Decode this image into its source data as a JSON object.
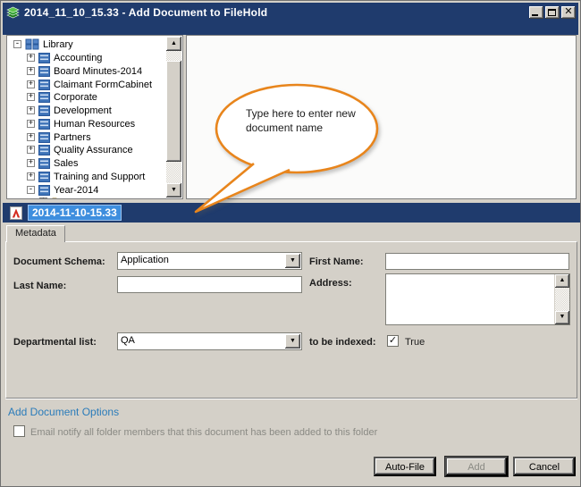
{
  "window": {
    "title": "2014_11_10_15.33 - Add Document to FileHold",
    "controls": [
      {
        "name": "minimize"
      },
      {
        "name": "maximize"
      },
      {
        "name": "close"
      }
    ],
    "app_icon": "filehold-green-layers-icon"
  },
  "colors": {
    "titlebar_navy": "#1f3b6d",
    "selection_blue": "#3e8ede",
    "callout_orange": "#e8851c",
    "link_blue": "#2b7cba",
    "chrome_gray": "#d4d0c8"
  },
  "tree": {
    "root": {
      "label": "Library",
      "toggle": "-",
      "icon": "library-grid-icon"
    },
    "items": [
      {
        "label": "Accounting",
        "toggle": "+",
        "icon": "cabinet-icon"
      },
      {
        "label": "Board Minutes-2014",
        "toggle": "+",
        "icon": "cabinet-icon"
      },
      {
        "label": "Claimant FormCabinet",
        "toggle": "+",
        "icon": "cabinet-icon"
      },
      {
        "label": "Corporate",
        "toggle": "+",
        "icon": "cabinet-icon"
      },
      {
        "label": "Development",
        "toggle": "+",
        "icon": "cabinet-icon"
      },
      {
        "label": "Human Resources",
        "toggle": "+",
        "icon": "cabinet-icon"
      },
      {
        "label": "Partners",
        "toggle": "+",
        "icon": "cabinet-icon"
      },
      {
        "label": "Quality Assurance",
        "toggle": "+",
        "icon": "cabinet-icon"
      },
      {
        "label": "Sales",
        "toggle": "+",
        "icon": "cabinet-icon"
      },
      {
        "label": "Training and Support",
        "toggle": "+",
        "icon": "cabinet-icon"
      },
      {
        "label": "Year-2014",
        "toggle": "-",
        "icon": "cabinet-icon"
      }
    ],
    "partial_item_icon": "folder-icon"
  },
  "callout": {
    "text": "Type here to enter new document name"
  },
  "filename": {
    "icon": "pdf-icon",
    "value": "2014-11-10-15.33"
  },
  "tab": {
    "label": "Metadata"
  },
  "form": {
    "schema": {
      "label": "Document Schema:",
      "value": "Application"
    },
    "first_name": {
      "label": "First Name:",
      "value": ""
    },
    "last_name": {
      "label": "Last Name:",
      "value": ""
    },
    "address": {
      "label": "Address:",
      "value": ""
    },
    "dept": {
      "label": "Departmental list:",
      "value": "QA"
    },
    "indexed": {
      "label": "to be indexed:",
      "value_label": "True",
      "checked_attr": "checked"
    }
  },
  "options": {
    "heading": "Add Document Options",
    "email_label": "Email notify all folder members that this document has been added to this folder"
  },
  "buttons": {
    "auto_file": "Auto-File",
    "add": "Add",
    "cancel": "Cancel"
  }
}
